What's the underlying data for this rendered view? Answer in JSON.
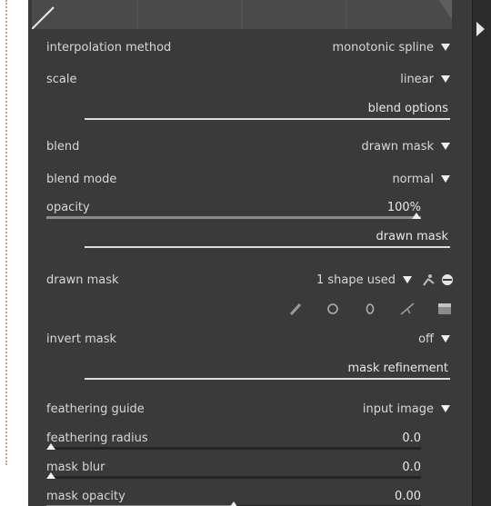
{
  "rows": {
    "interpolation": {
      "label": "interpolation method",
      "value": "monotonic spline"
    },
    "scale": {
      "label": "scale",
      "value": "linear"
    },
    "blend": {
      "label": "blend",
      "value": "drawn mask"
    },
    "blend_mode": {
      "label": "blend mode",
      "value": "normal"
    },
    "drawn_mask": {
      "label": "drawn mask",
      "value": "1 shape used"
    },
    "invert_mask": {
      "label": "invert mask",
      "value": "off"
    },
    "feathering_guide": {
      "label": "feathering guide",
      "value": "input image"
    }
  },
  "sections": {
    "blend_options": "blend options",
    "drawn_mask": "drawn mask",
    "mask_refinement": "mask refinement"
  },
  "sliders": {
    "opacity": {
      "label": "opacity",
      "value": "100%",
      "fraction": 1.0
    },
    "feathering_radius": {
      "label": "feathering radius",
      "value": "0.0",
      "fraction": 0.0
    },
    "mask_blur": {
      "label": "mask blur",
      "value": "0.0",
      "fraction": 0.0
    },
    "mask_opacity": {
      "label": "mask opacity",
      "value": "0.00",
      "fraction": 0.5
    }
  },
  "shape_tools": [
    "pencil-icon",
    "circle-icon",
    "ellipse-icon",
    "path-icon",
    "gradient-icon"
  ],
  "colors": {
    "panel": "#3a3a3a",
    "text": "#d8d8d8",
    "accent": "#f0f0f0"
  }
}
